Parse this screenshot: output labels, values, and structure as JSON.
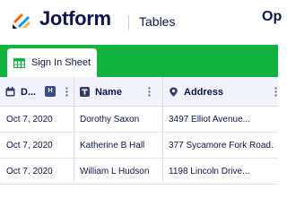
{
  "header": {
    "brand": "Jotform",
    "product": "Tables",
    "right_text": "Op"
  },
  "tab": {
    "label": "Sign In Sheet",
    "icon": "table-sheet-icon"
  },
  "table": {
    "columns": [
      {
        "label": "D...",
        "icon": "calendar-icon"
      },
      {
        "label": "Name",
        "icon": "text-type-icon"
      },
      {
        "label": "Address",
        "icon": "location-pin-icon"
      }
    ],
    "rows": [
      {
        "date": "Oct 7, 2020",
        "name": "Dorothy Saxon",
        "address": "3497 Elliot Avenue..."
      },
      {
        "date": "Oct 7, 2020",
        "name": "Katherine B Hall",
        "address": "377 Sycamore Fork Road..."
      },
      {
        "date": "Oct 7, 2020",
        "name": "William L Hudson",
        "address": "1198 Lincoln Drive..."
      }
    ]
  },
  "colors": {
    "brand_navy": "#0a1551",
    "tab_green": "#10b33b",
    "header_bg": "#f3f3fe"
  }
}
